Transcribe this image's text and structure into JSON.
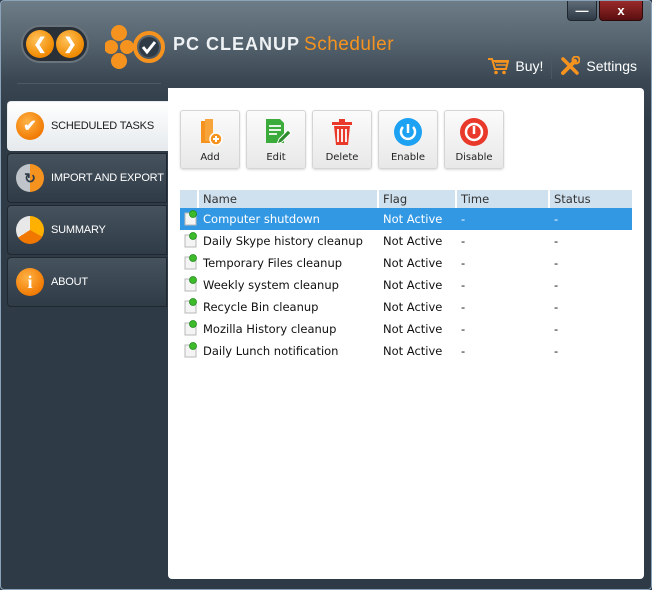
{
  "window": {
    "minimize_label": "—",
    "close_label": "x"
  },
  "header": {
    "brand_main": "PC CLEANUP",
    "brand_sub": "Scheduler",
    "back_icon": "chevron-left-icon",
    "forward_icon": "chevron-right-icon",
    "buy_label": "Buy!",
    "settings_label": "Settings"
  },
  "sidebar": {
    "items": [
      {
        "label": "SCHEDULED TASKS",
        "icon": "check-icon",
        "active": true
      },
      {
        "label": "IMPORT AND EXPORT",
        "icon": "sync-icon",
        "active": false
      },
      {
        "label": "SUMMARY",
        "icon": "pie-chart-icon",
        "active": false
      },
      {
        "label": "ABOUT",
        "icon": "info-icon",
        "active": false
      }
    ]
  },
  "toolbar": {
    "add_label": "Add",
    "edit_label": "Edit",
    "delete_label": "Delete",
    "enable_label": "Enable",
    "disable_label": "Disable"
  },
  "table": {
    "columns": [
      "",
      "Name",
      "Flag",
      "Time",
      "Status"
    ],
    "rows": [
      {
        "name": "Computer shutdown",
        "flag": "Not Active",
        "time": "-",
        "status": "-",
        "selected": true
      },
      {
        "name": "Daily Skype history cleanup",
        "flag": "Not Active",
        "time": "-",
        "status": "-",
        "selected": false
      },
      {
        "name": "Temporary Files cleanup",
        "flag": "Not Active",
        "time": "-",
        "status": "-",
        "selected": false
      },
      {
        "name": "Weekly system cleanup",
        "flag": "Not Active",
        "time": "-",
        "status": "-",
        "selected": false
      },
      {
        "name": "Recycle Bin cleanup",
        "flag": "Not Active",
        "time": "-",
        "status": "-",
        "selected": false
      },
      {
        "name": "Mozilla History cleanup",
        "flag": "Not Active",
        "time": "-",
        "status": "-",
        "selected": false
      },
      {
        "name": "Daily Lunch notification",
        "flag": "Not Active",
        "time": "-",
        "status": "-",
        "selected": false
      }
    ]
  },
  "colors": {
    "accent_orange": "#f6931e",
    "selection_blue": "#3398e4",
    "header_row": "#cfe0ee"
  }
}
